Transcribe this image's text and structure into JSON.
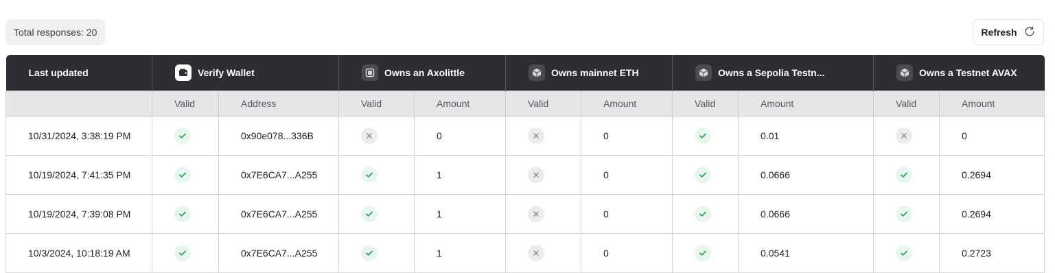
{
  "summary": {
    "total_label": "Total responses: 20"
  },
  "toolbar": {
    "refresh_label": "Refresh"
  },
  "colors": {
    "valid": "#2e9e5b",
    "invalid": "#8a8a8f",
    "header_bg": "#2d2d33"
  },
  "table": {
    "groups": [
      {
        "label": "Last updated",
        "icon": null
      },
      {
        "label": "Verify Wallet",
        "icon": "wallet-icon"
      },
      {
        "label": "Owns an Axolittle",
        "icon": "nft-icon"
      },
      {
        "label": "Owns mainnet ETH",
        "icon": "cube-icon"
      },
      {
        "label": "Owns a Sepolia Testn...",
        "icon": "cube-icon"
      },
      {
        "label": "Owns a Testnet AVAX",
        "icon": "cube-icon"
      }
    ],
    "subheaders": [
      "",
      "Valid",
      "Address",
      "Valid",
      "Amount",
      "Valid",
      "Amount",
      "Valid",
      "Amount",
      "Valid",
      "Amount"
    ],
    "rows": [
      {
        "updated": "10/31/2024, 3:38:19 PM",
        "wallet_valid": true,
        "address": "0x90e078...336B",
        "axo_valid": false,
        "axo_amount": "0",
        "eth_valid": false,
        "eth_amount": "0",
        "sepolia_valid": true,
        "sepolia_amount": "0.01",
        "avax_valid": false,
        "avax_amount": "0"
      },
      {
        "updated": "10/19/2024, 7:41:35 PM",
        "wallet_valid": true,
        "address": "0x7E6CA7...A255",
        "axo_valid": true,
        "axo_amount": "1",
        "eth_valid": false,
        "eth_amount": "0",
        "sepolia_valid": true,
        "sepolia_amount": "0.0666",
        "avax_valid": true,
        "avax_amount": "0.2694"
      },
      {
        "updated": "10/19/2024, 7:39:08 PM",
        "wallet_valid": true,
        "address": "0x7E6CA7...A255",
        "axo_valid": true,
        "axo_amount": "1",
        "eth_valid": false,
        "eth_amount": "0",
        "sepolia_valid": true,
        "sepolia_amount": "0.0666",
        "avax_valid": true,
        "avax_amount": "0.2694"
      },
      {
        "updated": "10/3/2024, 10:18:19 AM",
        "wallet_valid": true,
        "address": "0x7E6CA7...A255",
        "axo_valid": true,
        "axo_amount": "1",
        "eth_valid": false,
        "eth_amount": "0",
        "sepolia_valid": true,
        "sepolia_amount": "0.0541",
        "avax_valid": true,
        "avax_amount": "0.2723"
      }
    ]
  }
}
